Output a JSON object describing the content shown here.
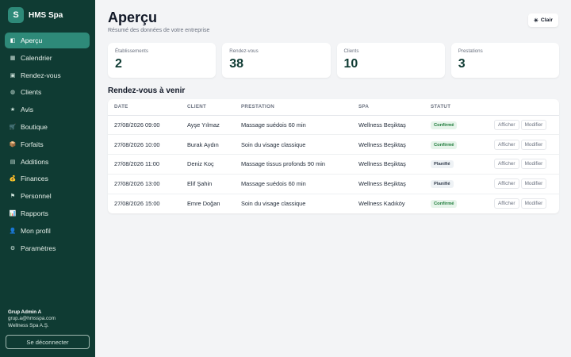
{
  "brand": {
    "logo_letter": "S",
    "name": "HMS Spa"
  },
  "sidebar": {
    "items": [
      {
        "label": "Aperçu",
        "icon": "overview-icon",
        "glyph": "◧",
        "active": true
      },
      {
        "label": "Calendrier",
        "icon": "calendar-icon",
        "glyph": "▦",
        "active": false
      },
      {
        "label": "Rendez-vous",
        "icon": "appointment-icon",
        "glyph": "▣",
        "active": false
      },
      {
        "label": "Clients",
        "icon": "clients-icon",
        "glyph": "◍",
        "active": false
      },
      {
        "label": "Avis",
        "icon": "star-icon",
        "glyph": "★",
        "active": false
      },
      {
        "label": "Boutique",
        "icon": "cart-icon",
        "glyph": "🛒",
        "active": false
      },
      {
        "label": "Forfaits",
        "icon": "package-icon",
        "glyph": "📦",
        "active": false
      },
      {
        "label": "Additions",
        "icon": "receipt-icon",
        "glyph": "▤",
        "active": false
      },
      {
        "label": "Finances",
        "icon": "money-bag-icon",
        "glyph": "💰",
        "active": false
      },
      {
        "label": "Personnel",
        "icon": "flag-icon",
        "glyph": "⚑",
        "active": false
      },
      {
        "label": "Rapports",
        "icon": "chart-icon",
        "glyph": "📊",
        "active": false
      },
      {
        "label": "Mon profil",
        "icon": "profile-icon",
        "glyph": "👤",
        "active": false
      },
      {
        "label": "Paramètres",
        "icon": "gear-icon",
        "glyph": "⚙",
        "active": false
      }
    ],
    "user": {
      "name": "Grup Admin A",
      "email": "grup.a@hmsspa.com",
      "company": "Wellness Spa A.Ş."
    },
    "logout_label": "Se déconnecter"
  },
  "header": {
    "title": "Aperçu",
    "subtitle": "Résumé des données de votre entreprise",
    "theme_button": {
      "icon": "sun-icon",
      "glyph": "☀",
      "label": "Clair"
    }
  },
  "stats": [
    {
      "label": "Établissements",
      "value": "2"
    },
    {
      "label": "Rendez-vous",
      "value": "38"
    },
    {
      "label": "Clients",
      "value": "10"
    },
    {
      "label": "Prestations",
      "value": "3"
    }
  ],
  "appointments": {
    "title": "Rendez-vous à venir",
    "columns": [
      "DATE",
      "CLIENT",
      "PRESTATION",
      "SPA",
      "STATUT",
      ""
    ],
    "view_label": "Afficher",
    "edit_label": "Modifier",
    "rows": [
      {
        "date": "27/08/2026 09:00",
        "client": "Ayşe Yılmaz",
        "service": "Massage suédois 60 min",
        "spa": "Wellness Beşiktaş",
        "status": "Confirmé",
        "status_type": "ok"
      },
      {
        "date": "27/08/2026 10:00",
        "client": "Burak Aydın",
        "service": "Soin du visage classique",
        "spa": "Wellness Beşiktaş",
        "status": "Confirmé",
        "status_type": "ok"
      },
      {
        "date": "27/08/2026 11:00",
        "client": "Deniz Koç",
        "service": "Massage tissus profonds 90 min",
        "spa": "Wellness Beşiktaş",
        "status": "Planifié",
        "status_type": "plan"
      },
      {
        "date": "27/08/2026 13:00",
        "client": "Elif Şahin",
        "service": "Massage suédois 60 min",
        "spa": "Wellness Beşiktaş",
        "status": "Planifié",
        "status_type": "plan"
      },
      {
        "date": "27/08/2026 15:00",
        "client": "Emre Doğan",
        "service": "Soin du visage classique",
        "spa": "Wellness Kadıköy",
        "status": "Confirmé",
        "status_type": "ok"
      }
    ]
  },
  "colors": {
    "sidebar_bg": "#0f3b33",
    "accent": "#2e8a79",
    "confirmed": "#1e7b3a"
  }
}
